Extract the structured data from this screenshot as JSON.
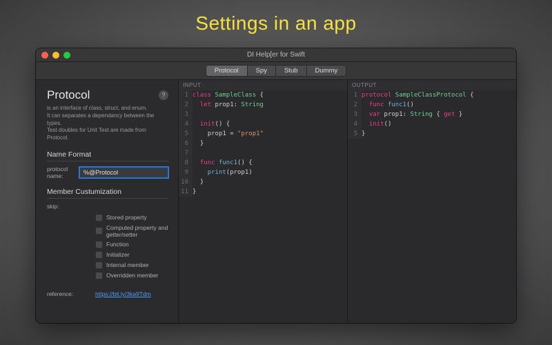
{
  "hero": "Settings in an app",
  "window": {
    "title": "DI Help[er for Swift"
  },
  "tabs": [
    {
      "label": "Protocol",
      "active": true
    },
    {
      "label": "Spy",
      "active": false
    },
    {
      "label": "Stub",
      "active": false
    },
    {
      "label": "Dummy",
      "active": false
    }
  ],
  "side": {
    "title": "Protocol",
    "desc_l1": "is an interface of class, struct, and enum.",
    "desc_l2": "It can separates a dependancy between the types.",
    "desc_l3": "Test doubles for Unit Test are made from Protocol.",
    "name_format_label": "Name Format",
    "protocol_name_label": "protocol name:",
    "protocol_name_value": "%@Protocol",
    "member_label": "Member Custumization",
    "skip_label": "skip:",
    "skips": [
      "Stored property",
      "Computed property and getter/setter",
      "Function",
      "Initializer",
      "Internal member",
      "Overridden member"
    ],
    "reference_label": "reference:",
    "reference_link": "https://bit.ly/3ka9Tdm"
  },
  "panes": {
    "input_label": "INPUT",
    "output_label": "OUTPUT"
  },
  "chart_data": null
}
